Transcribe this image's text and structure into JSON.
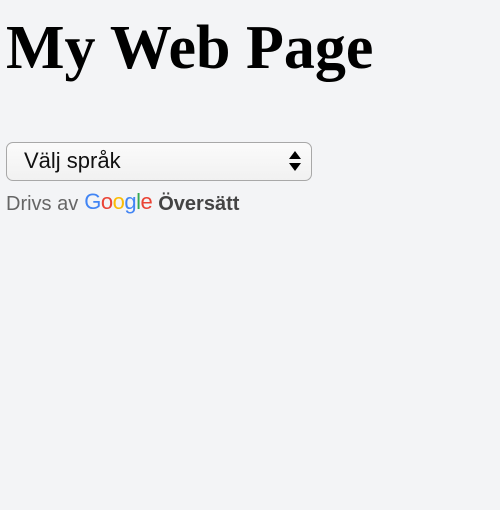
{
  "page": {
    "title": "My Web Page"
  },
  "translate_widget": {
    "select": {
      "selected": "Välj språk"
    },
    "powered_by": {
      "prefix": "Drivs av",
      "logo_letters": [
        {
          "char": "G",
          "color": "#4285F4"
        },
        {
          "char": "o",
          "color": "#EA4335"
        },
        {
          "char": "o",
          "color": "#FBBC05"
        },
        {
          "char": "g",
          "color": "#4285F4"
        },
        {
          "char": "l",
          "color": "#34A853"
        },
        {
          "char": "e",
          "color": "#EA4335"
        }
      ],
      "link_label": "Översätt"
    }
  }
}
